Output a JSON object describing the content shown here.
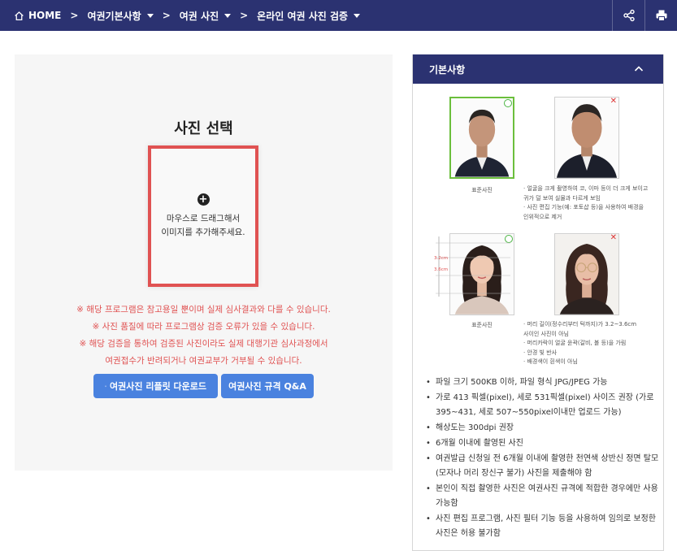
{
  "nav": {
    "home": "HOME",
    "item1": "여권기본사항",
    "item2": "여권 사진",
    "item3": "온라인 여권 사진 검증"
  },
  "left": {
    "title": "사진 선택",
    "drop_line1": "마우스로 드래그해서",
    "drop_line2": "이미지를 추가해주세요.",
    "notes": [
      "※ 해당 프로그램은 참고용일 뿐이며 실제 심사결과와 다를 수 있습니다.",
      "※ 사진 품질에 따라 프로그램상 검증 오류가 있을 수 있습니다.",
      "※ 해당 검증을 통하여 검증된 사진이라도 실제 대행기관 심사과정에서",
      "여권접수가 반려되거나 여권교부가 거부될 수 있습니다."
    ],
    "btn_download": "여권사진 리플릿 다운로드",
    "btn_qa": "여권사진 규격 Q&A"
  },
  "right": {
    "header": "기본사항",
    "caption_standard_1": "표준사진",
    "caption_standard_2": "표준사진",
    "desc1": [
      "· 얼굴을 크게 촬영하여 코, 이마 등이 더 크게 보이고",
      "  귀가 덜 보여 실물과 다르게 보임",
      "· 사진 편집 기능(예: 포토샵 등)을 사용하여 배경을",
      "  인위적으로 제거"
    ],
    "desc2": [
      "· 머리 길이(정수리부터 턱까지)가 3.2~3.6cm",
      "  사이인 사진이 아님",
      "· 머리카락이 얼굴 윤곽(갈비, 볼 등)을 가림",
      "· 안경 빛 반사",
      "· 배경색이 흰색이 아님"
    ],
    "guide1": "3.2cm",
    "guide2": "3.6cm",
    "specs": [
      "파일 크기 500KB 이하, 파일 형식 JPG/JPEG 가능",
      "가로 413 픽셀(pixel), 세로 531픽셀(pixel) 사이즈 권장 (가로 395~431, 세로 507~550pixel이내만 업로드 가능)",
      "해상도는 300dpi 권장",
      "6개월 이내에 촬영된 사진",
      "여권발급 신청일 전 6개월 이내에 촬영한 천연색 상반신 정면 탈모(모자나 머리 장신구 불가) 사진을 제출해야 함",
      "본인이 직접 촬영한 사진은 여권사진 규격에 적합한 경우에만 사용가능함",
      "사진 편집 프로그램, 사진 필터 기능 등을 사용하여 임의로 보정한 사진은 허용 불가함"
    ]
  },
  "colors": {
    "nav_bg": "#2b3271",
    "accent_blue": "#4a82df",
    "warning_red": "#e05252",
    "good_green": "#6bbf3c"
  }
}
